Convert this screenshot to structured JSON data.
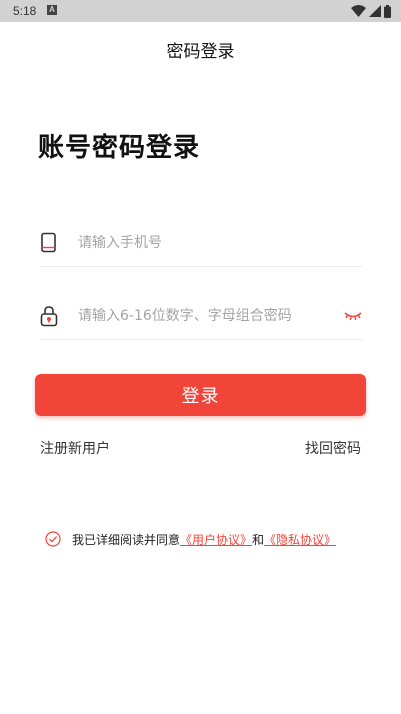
{
  "status_bar": {
    "time": "5:18",
    "notification_badge": "A"
  },
  "app_bar": {
    "title": "密码登录"
  },
  "heading": "账号密码登录",
  "phone_field": {
    "value": "",
    "placeholder": "请输入手机号",
    "icon": "phone-icon"
  },
  "password_field": {
    "value": "",
    "placeholder": "请输入6-16位数字、字母组合密码",
    "icon": "lock-icon",
    "toggle_icon": "eye-closed-icon"
  },
  "login_button": {
    "label": "登录"
  },
  "links": {
    "register": "注册新用户",
    "forgot_password": "找回密码"
  },
  "agreement": {
    "prefix": "我已详细阅读并同意",
    "user_agreement": "《用户协议》",
    "conjunction": "和",
    "privacy_policy": "《隐私协议》"
  },
  "colors": {
    "accent": "#f2453a",
    "status_bar": "#d2d2d2",
    "placeholder": "#a4a4a4",
    "divider": "#ececec"
  }
}
